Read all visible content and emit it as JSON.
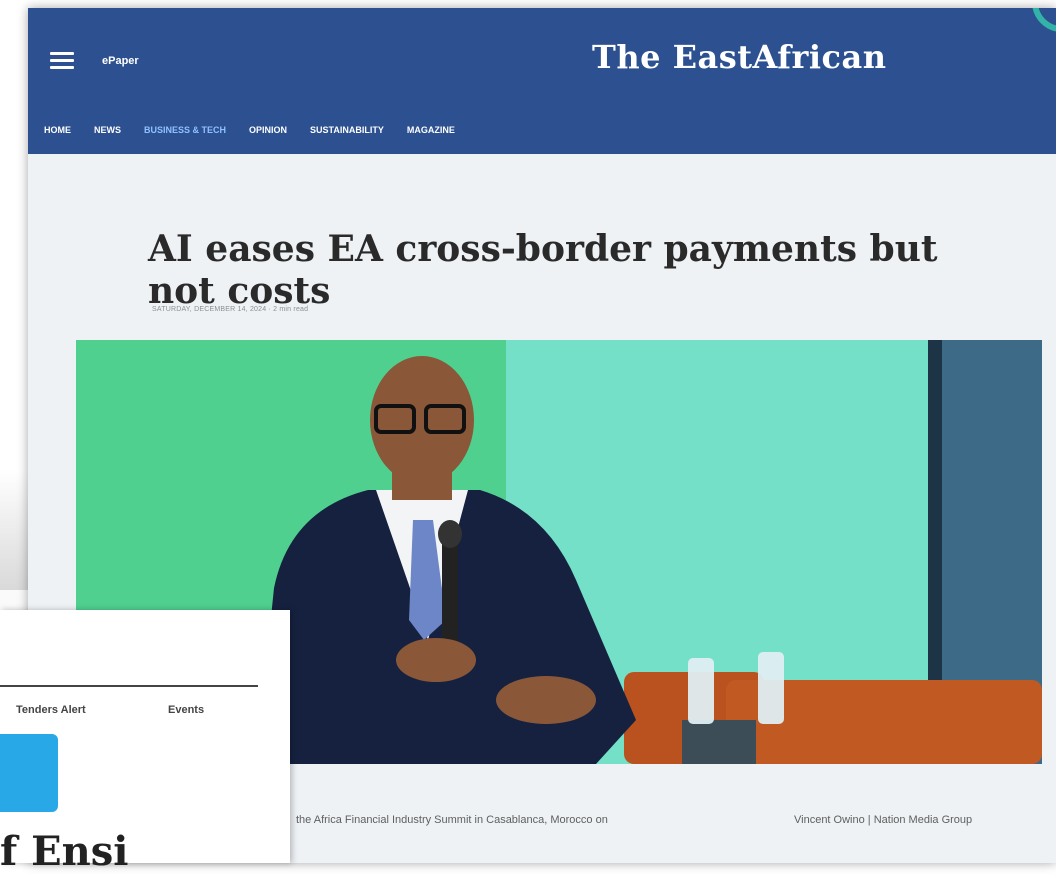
{
  "site": {
    "epaper_label": "ePaper",
    "brand_name": "The EastAfrican",
    "brand_color": "#2c5090"
  },
  "nav": {
    "items": [
      "HOME",
      "NEWS",
      "BUSINESS & TECH",
      "OPINION",
      "SUSTAINABILITY",
      "MAGAZINE"
    ],
    "active_index": 2
  },
  "article": {
    "headline": "AI eases EA cross-border payments but not costs",
    "dateline": "SATURDAY, DECEMBER 14, 2024 · 2 min read",
    "image_caption": "the Africa Financial Industry Summit in Casablanca, Morocco on",
    "image_credit": "Vincent Owino | Nation Media Group"
  },
  "overlay_page": {
    "tabs": [
      "Tenders Alert",
      "Events"
    ],
    "partial_heading": "f Ensi"
  }
}
